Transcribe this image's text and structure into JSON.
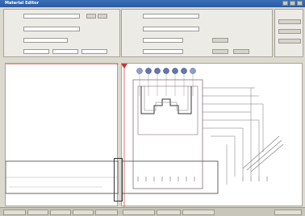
{
  "window": {
    "title": "Material Editor",
    "accent": "#2d5ea6"
  },
  "form": {
    "left_fields": [
      "",
      "",
      "",
      ""
    ],
    "right_fields": [
      "",
      "",
      "",
      ""
    ]
  },
  "canvas": {
    "toolbar_icons": [
      "circle-icon",
      "circle-icon",
      "circle-icon",
      "circle-icon",
      "circle-icon",
      "circle-icon"
    ]
  },
  "status": {
    "items": [
      "",
      "",
      "",
      "",
      "",
      "",
      "",
      "",
      ""
    ]
  }
}
